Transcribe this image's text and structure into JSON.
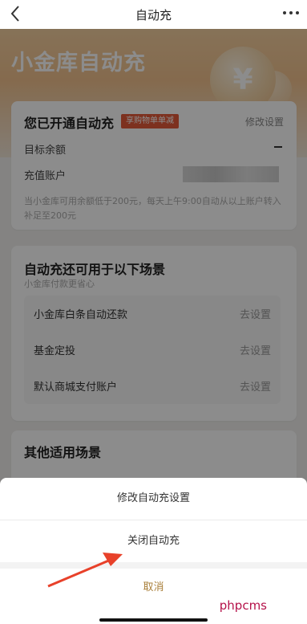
{
  "topbar": {
    "title": "自动充"
  },
  "hero": {
    "title": "小金库自动充",
    "coin_symbol": "¥"
  },
  "status_card": {
    "heading": "您已开通自动充",
    "promo_badge": "享购物单单减",
    "edit_link": "修改设置",
    "target_balance_label": "目标余额",
    "target_balance_value": "–",
    "recharge_account_label": "充值账户",
    "note": "当小金库可用余额低于200元，每天上午9:00自动从以上账户转入补足至200元"
  },
  "scenes_card": {
    "heading": "自动充还可用于以下场景",
    "subheading": "小金库付款更省心",
    "items": [
      {
        "label": "小金库白条自动还款",
        "action": "去设置"
      },
      {
        "label": "基金定投",
        "action": "去设置"
      },
      {
        "label": "默认商城支付账户",
        "action": "去设置"
      }
    ]
  },
  "other_card": {
    "heading": "其他适用场景"
  },
  "action_sheet": {
    "modify_label": "修改自动充设置",
    "close_label": "关闭自动充",
    "cancel_label": "取消"
  },
  "watermark": "phpcms",
  "colors": {
    "cancel": "#a97f3a",
    "promo": "#e35a3a",
    "arrow": "#e8412a",
    "watermark": "#b5124a"
  }
}
